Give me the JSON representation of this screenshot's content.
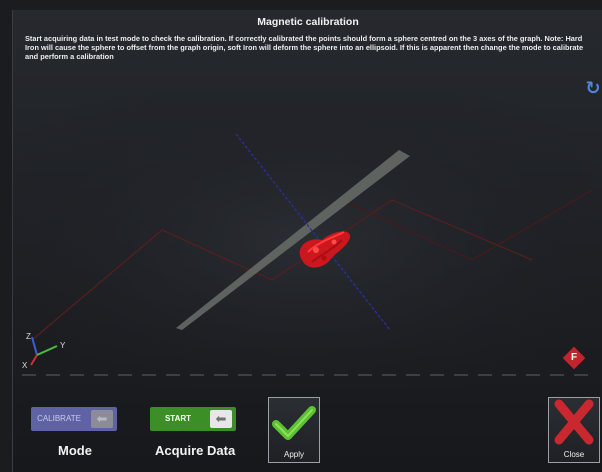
{
  "dialog": {
    "title": "Magnetic calibration",
    "description": "Start acquiring data in test mode to check the calibration. If correctly calibrated the points should form a sphere centred on the 3 axes of the graph. Note: Hard Iron will cause the sphere to offset from the graph origin, soft Iron will deform the sphere into an ellipsoid. If this is apparent then change the mode to calibrate and perform a calibration"
  },
  "axes_gizmo": {
    "z": "Z",
    "y": "Y",
    "x": "X"
  },
  "face_badge": "F",
  "controls": {
    "mode": {
      "toggle_label": "CALIBRATE",
      "caption": "Mode",
      "active": false
    },
    "acquire": {
      "toggle_label": "START",
      "caption": "Acquire Data",
      "active": true
    }
  },
  "buttons": {
    "apply": "Apply",
    "close": "Close"
  },
  "colors": {
    "accent_blue": "#4f87d8",
    "start_green": "#3b8f26",
    "calibrate_purple": "#5f63a5",
    "data_points_red": "#e0141a",
    "close_red": "#c8282e",
    "apply_green": "#5cc232"
  },
  "icons": {
    "refresh": "refresh-icon",
    "toggle_arrow": "arrow-left-icon",
    "apply": "checkmark-icon",
    "close": "x-icon"
  }
}
